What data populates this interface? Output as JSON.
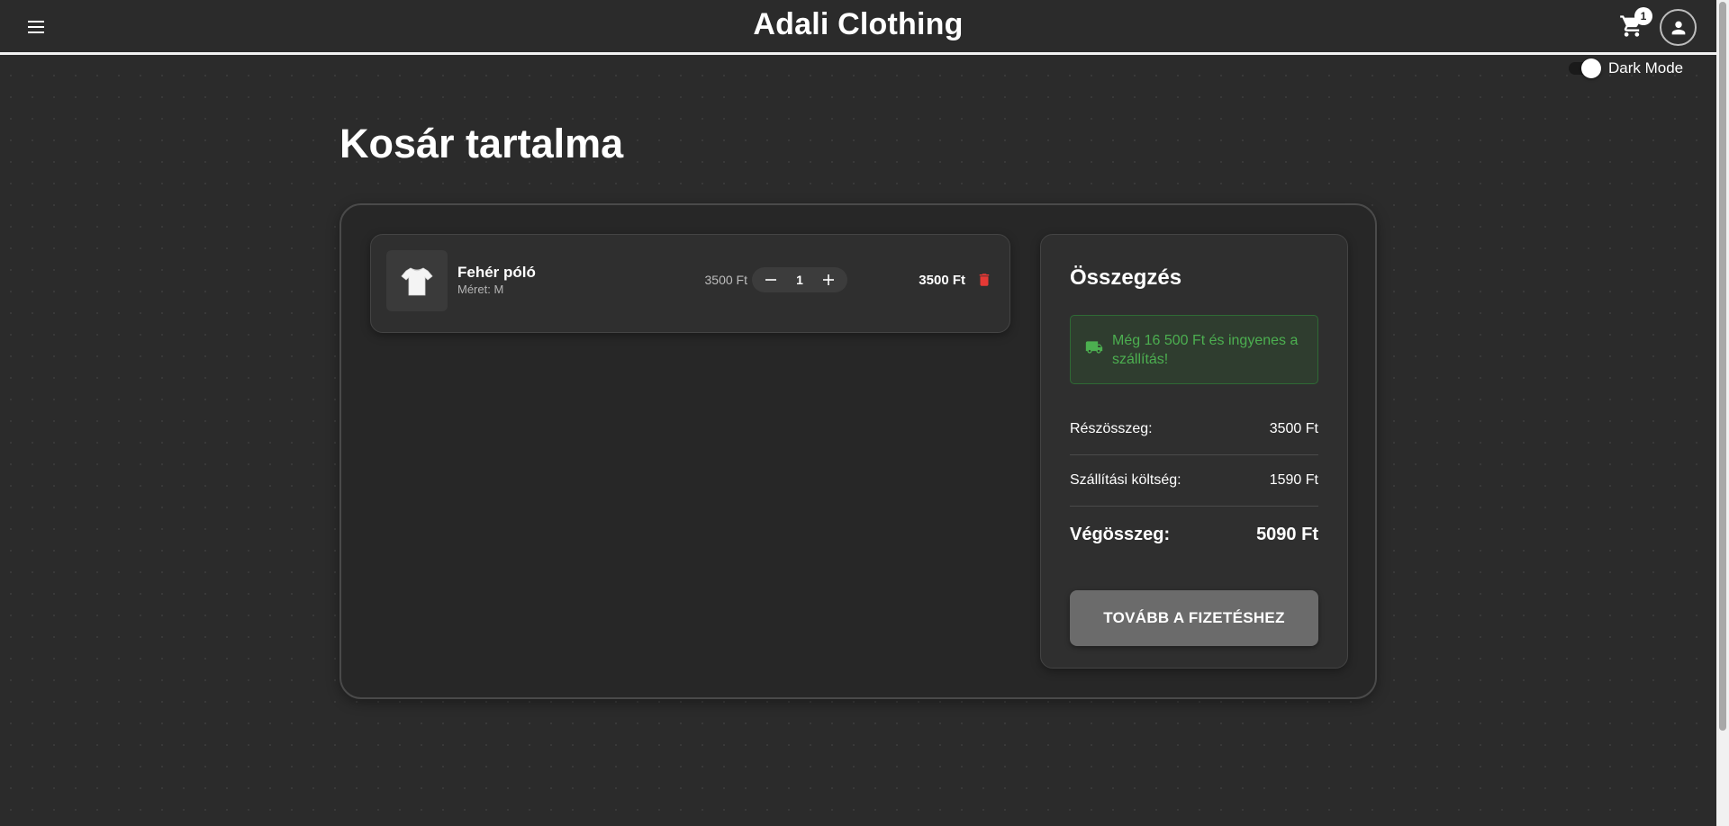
{
  "header": {
    "brand": "Adali Clothing",
    "cart_count": "1"
  },
  "dark_mode": {
    "label": "Dark Mode",
    "enabled": true
  },
  "page_title": "Kosár tartalma",
  "cart": {
    "items": [
      {
        "name": "Fehér póló",
        "size_label": "Méret: M",
        "unit_price": "3500 Ft",
        "quantity": "1",
        "line_total": "3500 Ft"
      }
    ]
  },
  "summary": {
    "title": "Összegzés",
    "shipping_note": "Még 16 500 Ft és ingyenes a szállítás!",
    "subtotal_label": "Részösszeg:",
    "subtotal_value": "3500 Ft",
    "shipping_label": "Szállítási költség:",
    "shipping_value": "1590 Ft",
    "total_label": "Végösszeg:",
    "total_value": "5090 Ft",
    "checkout_label": "TOVÁBB A FIZETÉSHEZ"
  },
  "colors": {
    "background": "#2b2b2b",
    "accent_green": "#4caf50",
    "delete_red": "#e53935",
    "button_gray": "#6b6b6b"
  },
  "icons": {
    "menu": "menu-icon",
    "cart": "shopping-cart-icon",
    "account": "account-icon",
    "minus": "minus-icon",
    "plus": "plus-icon",
    "delete": "trash-icon",
    "shipping": "truck-icon",
    "product": "t-shirt-icon"
  }
}
